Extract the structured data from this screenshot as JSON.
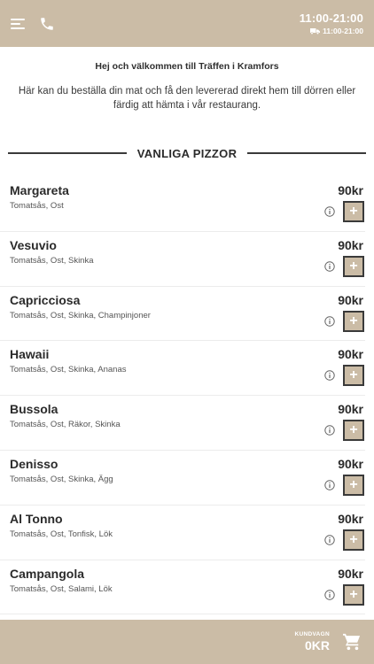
{
  "header": {
    "hours": "11:00-21:00",
    "delivery_hours": "11:00-21:00",
    "icons": [
      "menu-icon",
      "phone-icon",
      "truck-icon"
    ]
  },
  "welcome": {
    "title": "Hej och välkommen till Träffen i Kramfors",
    "text": "Här kan du beställa din mat och få den levererad direkt hem till dörren eller färdig att hämta i vår restaurang."
  },
  "section": {
    "title": "VANLIGA PIZZOR"
  },
  "items": [
    {
      "name": "Margareta",
      "desc": "Tomatsås, Ost",
      "price": "90kr",
      "add": "+"
    },
    {
      "name": "Vesuvio",
      "desc": "Tomatsås, Ost, Skinka",
      "price": "90kr",
      "add": "+"
    },
    {
      "name": "Capricciosa",
      "desc": "Tomatsås, Ost, Skinka, Champinjoner",
      "price": "90kr",
      "add": "+"
    },
    {
      "name": "Hawaii",
      "desc": "Tomatsås, Ost, Skinka, Ananas",
      "price": "90kr",
      "add": "+"
    },
    {
      "name": "Bussola",
      "desc": "Tomatsås, Ost, Räkor, Skinka",
      "price": "90kr",
      "add": "+"
    },
    {
      "name": "Denisso",
      "desc": "Tomatsås, Ost, Skinka, Ägg",
      "price": "90kr",
      "add": "+"
    },
    {
      "name": "Al Tonno",
      "desc": "Tomatsås, Ost, Tonfisk, Lök",
      "price": "90kr",
      "add": "+"
    },
    {
      "name": "Campangola",
      "desc": "Tomatsås, Ost, Salami, Lök",
      "price": "90kr",
      "add": "+"
    }
  ],
  "footer": {
    "cart_label": "KUNDVAGN",
    "cart_total": "0KR"
  },
  "colors": {
    "accent": "#cbbca6",
    "text": "#2b2b2b"
  }
}
